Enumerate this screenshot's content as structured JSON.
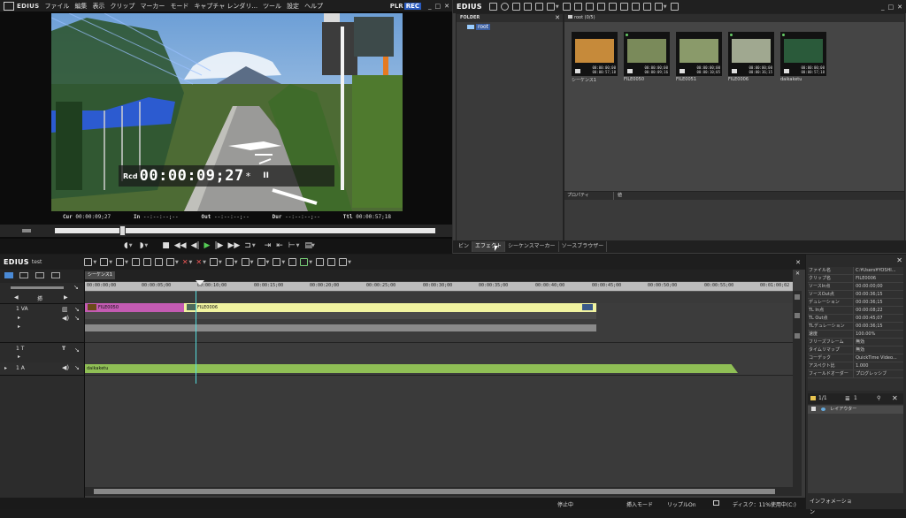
{
  "app": {
    "name": "EDIUS"
  },
  "player": {
    "menu": [
      "ファイル",
      "編集",
      "表示",
      "クリップ",
      "マーカー",
      "モード",
      "キャプチャ",
      "レンダリ...",
      "ツール",
      "設定",
      "ヘルプ"
    ],
    "mode_plr": "PLR",
    "mode_rec": "REC",
    "tc_label": "Rcd",
    "timecode": "00:00:09;27",
    "tc_suffix": "*",
    "pause_glyph": "II",
    "cur_label": "Cur",
    "cur_value": "00:00:09;27",
    "in_label": "In",
    "in_value": "--:--:--;--",
    "out_label": "Out",
    "out_value": "--:--:--;--",
    "dur_label": "Dur",
    "dur_value": "--:--:--;--",
    "ttl_label": "Ttl",
    "ttl_value": "00:00:57;18"
  },
  "bin": {
    "title": "EDIUS",
    "folder_header": "FOLDER",
    "root_label": "root",
    "clips_header": "root (0/5)",
    "clips": [
      {
        "name": "シーケンス1",
        "time_in": "00:00:00;00",
        "time_out": "00:00:57;18",
        "thumb_color": "#c68a3a",
        "type": "sequence"
      },
      {
        "name": "FILE0050",
        "time_in": "00:00:00;00",
        "time_out": "00:00:09;16",
        "thumb_color": "#7a8a5a",
        "type": "video"
      },
      {
        "name": "FILE0051",
        "time_in": "00:00:00;00",
        "time_out": "00:00:10;05",
        "thumb_color": "#8a9a6a",
        "type": "video"
      },
      {
        "name": "FILE0006",
        "time_in": "00:00:00;00",
        "time_out": "00:00:36;15",
        "thumb_color": "#a0a890",
        "type": "video"
      },
      {
        "name": "daikaketu",
        "time_in": "00:00:00;00",
        "time_out": "00:00:57;18",
        "thumb_color": "#2a5a3a",
        "type": "audio"
      }
    ],
    "prop_col1": "プロパティ",
    "prop_col2": "値",
    "tabs": [
      "ビン",
      "エフェクト",
      "シーケンスマーカー",
      "ソースブラウザー"
    ],
    "active_tab": 1
  },
  "timeline": {
    "app_name": "EDIUS",
    "project_name": "test",
    "sequence_tab": "シーケンス1",
    "mode_label": "挿",
    "ruler": [
      "00:00:00;00",
      "00:00:05;00",
      "00:00:10;00",
      "00:00:15;00",
      "00:00:20;00",
      "00:00:25;00",
      "00:00:30;00",
      "00:00:35;00",
      "00:00:40;00",
      "00:00:45;00",
      "00:00:50;00",
      "00:00:55;00",
      "00:01:00;02"
    ],
    "tracks": {
      "va": "1 VA",
      "t": "1 T",
      "a": "1 A"
    },
    "clips": {
      "va1": "FILE0050",
      "va2": "FILE0006",
      "a1": "daikaketu"
    },
    "status": {
      "state": "停止中",
      "insert_mode": "挿入モード",
      "ripple": "リップルOn",
      "disk": "ディスク：11%使用中(C:)"
    }
  },
  "info": {
    "rows": [
      {
        "key": "ファイル名",
        "value": "C:¥Users¥YOSHI..."
      },
      {
        "key": "クリップ名",
        "value": "FILE0006"
      },
      {
        "key": "ソースIn点",
        "value": "00:00:00;00"
      },
      {
        "key": "ソースOut点",
        "value": "00:00:36;15"
      },
      {
        "key": "デュレーション",
        "value": "00:00:36;15"
      },
      {
        "key": "TL In点",
        "value": "00:00:08;22"
      },
      {
        "key": "TL Out点",
        "value": "00:00:45;07"
      },
      {
        "key": "TLデュレーション",
        "value": "00:00:36;15"
      },
      {
        "key": "速度",
        "value": "100.00%"
      },
      {
        "key": "フリーズフレーム",
        "value": "無効"
      },
      {
        "key": "タイムリマップ",
        "value": "無効"
      },
      {
        "key": "コーデック",
        "value": "QuickTime Video..."
      },
      {
        "key": "アスペクト比",
        "value": "1.000"
      },
      {
        "key": "フィールドオーダー",
        "value": "プログレッシブ"
      }
    ],
    "page_counter": "1/1",
    "layer_count": "1",
    "layer_name": "レイアウター",
    "tab": "インフォメーション"
  }
}
